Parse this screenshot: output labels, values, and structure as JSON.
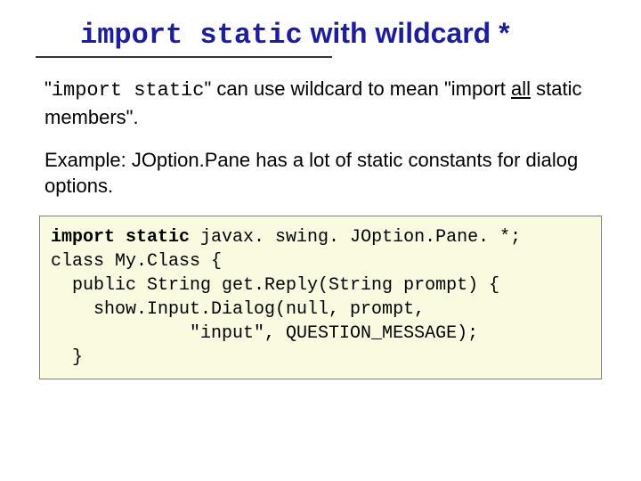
{
  "title": {
    "mono": "import static",
    "rest": " with wildcard *"
  },
  "para1": {
    "open_quote": "\"",
    "mono": "import static",
    "after_mono": "\" can use wildcard to mean \"import ",
    "underline": "all",
    "tail": " static members\"."
  },
  "para2": "Example: JOption.Pane has a lot of static constants for dialog options.",
  "code": {
    "line1_bold": "import static",
    "line1_rest": " javax. swing. JOption.Pane. *;",
    "line2": "class My.Class {",
    "line3": "  public String get.Reply(String prompt) {",
    "line4": "    show.Input.Dialog(null, prompt,",
    "line5": "             \"input\", QUESTION_MESSAGE);",
    "line6": "  }"
  }
}
